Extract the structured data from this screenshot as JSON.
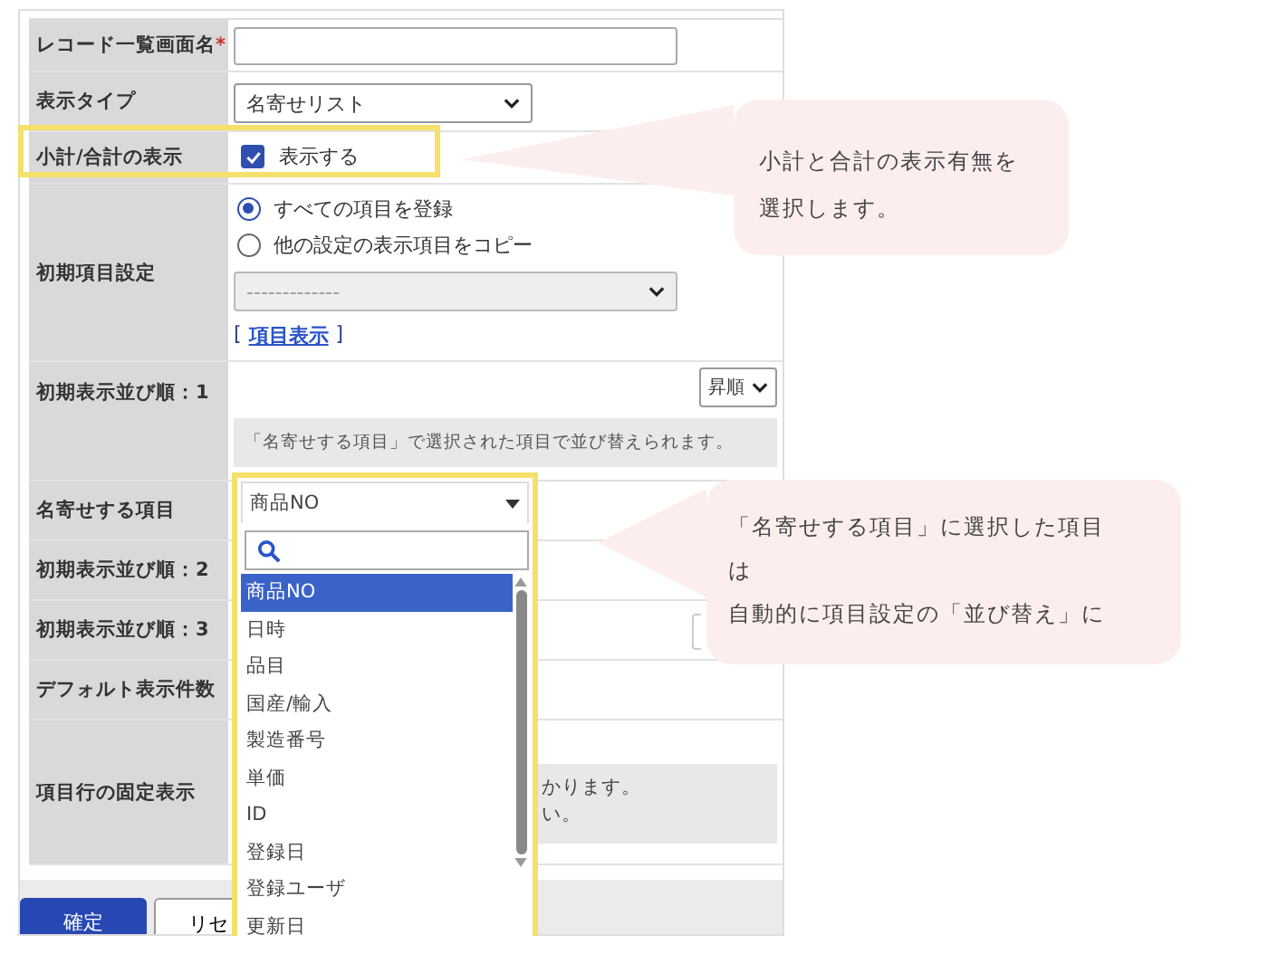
{
  "form": {
    "rows": [
      {
        "kind": "text",
        "label": "レコード一覧画面名",
        "required_mark": "*"
      },
      {
        "kind": "select",
        "label": "表示タイプ",
        "value": "名寄せリスト"
      },
      {
        "kind": "checkbox",
        "label": "小計/合計の表示",
        "checked": true,
        "text": "表示する"
      },
      {
        "kind": "radios",
        "label": "初期項目設定",
        "options": [
          {
            "label": "すべての項目を登録",
            "selected": true
          },
          {
            "label": "他の設定の表示項目をコピー",
            "selected": false
          }
        ],
        "select_value": "-------------",
        "link_open": "[",
        "link": "項目表示",
        "link_close": "]"
      },
      {
        "kind": "sort",
        "label": "初期表示並び順：1",
        "order": "昇順",
        "note": "「名寄せする項目」で選択された項目で並び替えられます。"
      },
      {
        "kind": "plain",
        "label": "名寄せする項目"
      },
      {
        "kind": "sort_hidden",
        "label": "初期表示並び順：2"
      },
      {
        "kind": "sort_hidden",
        "label": "初期表示並び順：3"
      },
      {
        "kind": "plain",
        "label": "デフォルト表示件数"
      },
      {
        "kind": "note_hidden",
        "label": "項目行の固定表示",
        "note_lines": [
          "かります。",
          "い。"
        ]
      }
    ]
  },
  "buttons": [
    {
      "kind": "primary",
      "label": "確定"
    },
    {
      "kind": "secondary",
      "label": "リセ"
    }
  ],
  "dropdown": {
    "value": "商品NO",
    "items": [
      {
        "label": "商品NO",
        "selected": true
      },
      {
        "label": "日時",
        "selected": false
      },
      {
        "label": "品目",
        "selected": false
      },
      {
        "label": "国産/輸入",
        "selected": false
      },
      {
        "label": "製造番号",
        "selected": false
      },
      {
        "label": "単価",
        "selected": false
      },
      {
        "label": "ID",
        "selected": false
      },
      {
        "label": "登録日",
        "selected": false
      },
      {
        "label": "登録ユーザ",
        "selected": false
      },
      {
        "label": "更新日",
        "selected": false
      }
    ]
  },
  "callouts": [
    {
      "lines": [
        "小計と合計の表示有無を",
        "選択します。"
      ]
    },
    {
      "lines": [
        "「名寄せする項目」に選択した項目",
        "は",
        "自動的に項目設定の「並び替え」に"
      ]
    }
  ]
}
